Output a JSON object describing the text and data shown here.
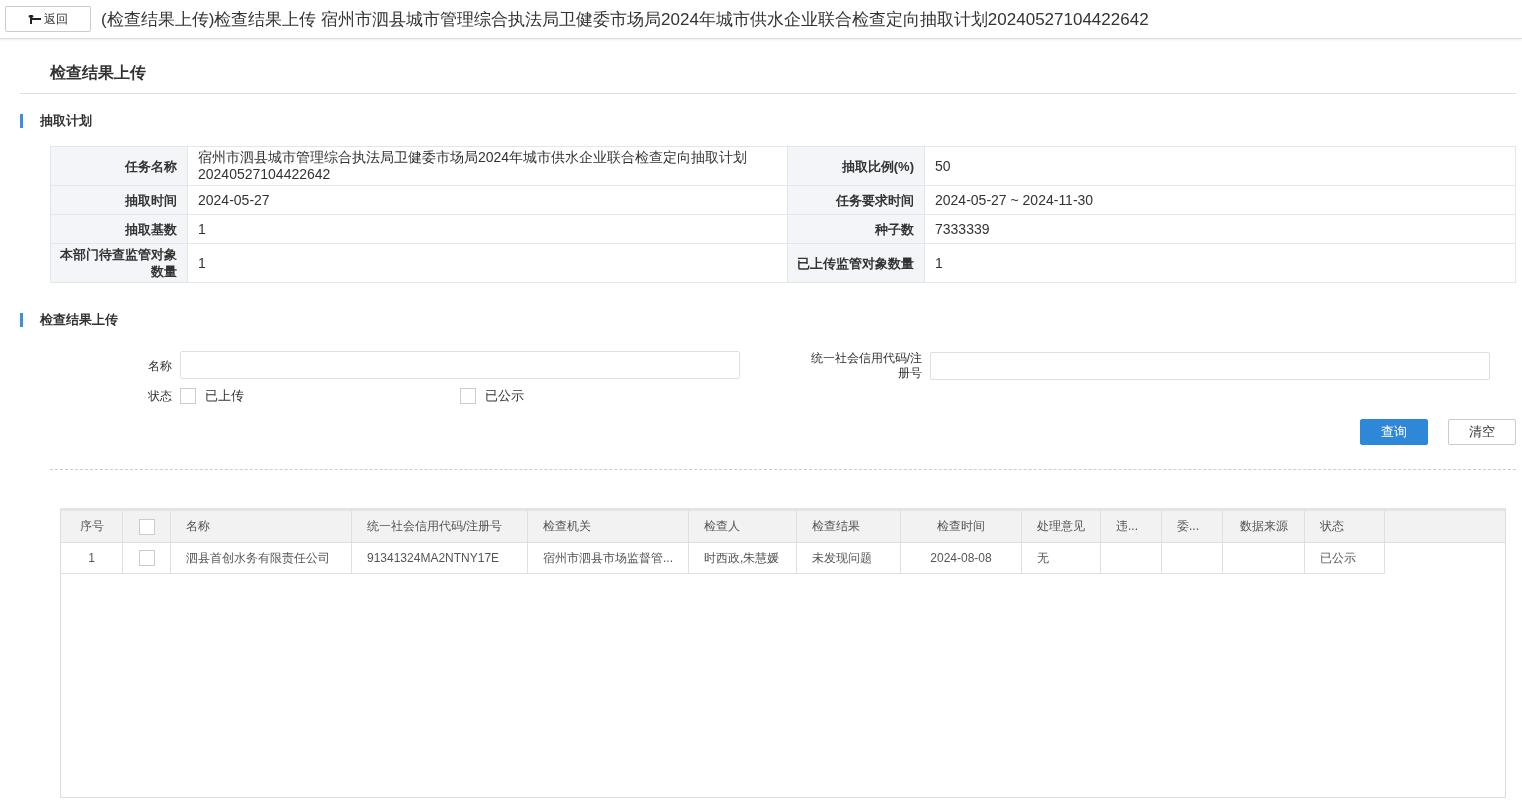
{
  "header": {
    "back_button": "返回",
    "title": "(检查结果上传)检查结果上传 宿州市泗县城市管理综合执法局卫健委市场局2024年城市供水企业联合检查定向抽取计划20240527104422642"
  },
  "page_title": "检查结果上传",
  "plan": {
    "heading": "抽取计划",
    "rows": [
      {
        "label_1": "任务名称",
        "value_1": "宿州市泗县城市管理综合执法局卫健委市场局2024年城市供水企业联合检查定向抽取计划20240527104422642",
        "label_2": "抽取比例(%)",
        "value_2": "50"
      },
      {
        "label_1": "抽取时间",
        "value_1": "2024-05-27",
        "label_2": "任务要求时间",
        "value_2": "2024-05-27 ~ 2024-11-30"
      },
      {
        "label_1": "抽取基数",
        "value_1": "1",
        "label_2": "种子数",
        "value_2": "7333339"
      },
      {
        "label_1": "本部门待查监管对象数量",
        "value_1": "1",
        "label_2": "已上传监管对象数量",
        "value_2": "1"
      }
    ]
  },
  "upload": {
    "heading": "检查结果上传",
    "name_label": "名称",
    "code_label": "统一社会信用代码/注册号",
    "status_label": "状态",
    "status_options": [
      {
        "label": "已上传",
        "checked": false
      },
      {
        "label": "已公示",
        "checked": false
      }
    ],
    "query_button": "查询",
    "clear_button": "清空"
  },
  "table": {
    "header_checked": false,
    "columns": [
      {
        "kind": "text",
        "label": "序号"
      },
      {
        "kind": "check"
      },
      {
        "kind": "text",
        "label": "名称"
      },
      {
        "kind": "text",
        "label": "统一社会信用代码/注册号"
      },
      {
        "kind": "text",
        "label": "检查机关"
      },
      {
        "kind": "text",
        "label": "检查人"
      },
      {
        "kind": "text",
        "label": "检查结果"
      },
      {
        "kind": "text",
        "label": "检查时间"
      },
      {
        "kind": "text",
        "label": "处理意见"
      },
      {
        "kind": "text",
        "label": "违..."
      },
      {
        "kind": "text",
        "label": "委..."
      },
      {
        "kind": "text",
        "label": "数据来源"
      },
      {
        "kind": "text",
        "label": "状态"
      }
    ],
    "rows": [
      {
        "checked": false,
        "cells": [
          "1",
          "",
          "泗县首创水务有限责任公司",
          "91341324MA2NTNY17E",
          "宿州市泗县市场监督管...",
          "时西政,朱慧媛",
          "未发现问题",
          "2024-08-08",
          "无",
          "",
          "",
          "",
          "已公示"
        ]
      }
    ]
  }
}
